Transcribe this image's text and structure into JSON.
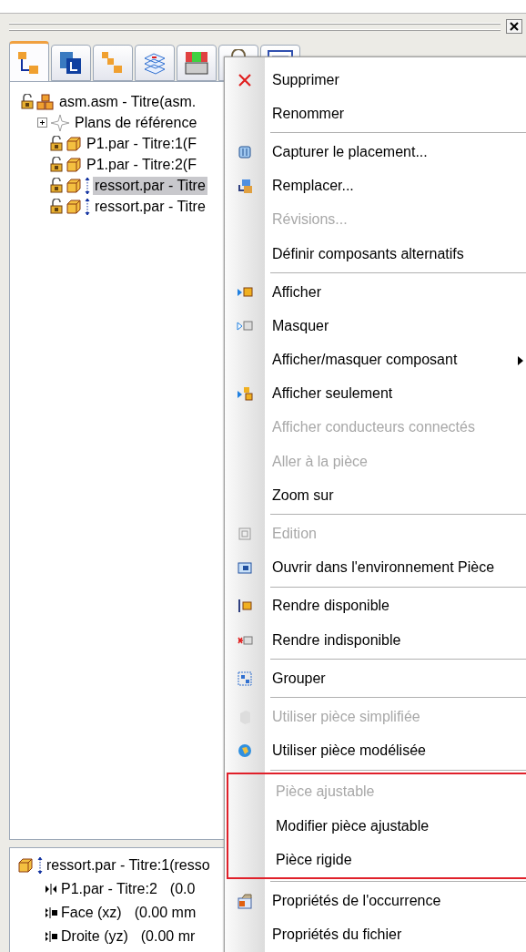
{
  "tabs": [
    {
      "selected": true
    },
    {
      "selected": false
    },
    {
      "selected": false
    },
    {
      "selected": false
    },
    {
      "selected": false
    },
    {
      "selected": false
    },
    {
      "selected": false
    }
  ],
  "tree": {
    "items": [
      {
        "label": "asm.asm - Titre(asm.",
        "selected": false,
        "kind": "assembly",
        "children": [
          {
            "label": "Plans de référence",
            "selected": false,
            "kind": "planes",
            "expanded": false
          },
          {
            "label": "P1.par - Titre:1(F",
            "selected": false,
            "kind": "part"
          },
          {
            "label": "P1.par - Titre:2(F",
            "selected": false,
            "kind": "part"
          },
          {
            "label": "ressort.par - Titre",
            "selected": true,
            "kind": "adjustable"
          },
          {
            "label": "ressort.par - Titre",
            "selected": false,
            "kind": "adjustable"
          }
        ]
      }
    ]
  },
  "details": {
    "header": "ressort.par - Titre:1(resso",
    "rows": [
      {
        "kind": "mate",
        "label": "P1.par - Titre:2",
        "value": "(0.0"
      },
      {
        "kind": "align",
        "label": "Face (xz)",
        "value": "(0.00 mm"
      },
      {
        "kind": "align",
        "label": "Droite (yz)",
        "value": "(0.00 mr"
      }
    ]
  },
  "context_menu": {
    "sections": [
      {
        "highlighted": false,
        "items": [
          {
            "label": "Supprimer",
            "disabled": false,
            "submenu": false
          },
          {
            "label": "Renommer",
            "disabled": false,
            "submenu": false
          }
        ]
      },
      {
        "highlighted": false,
        "items": [
          {
            "label": "Capturer le placement...",
            "disabled": false,
            "submenu": false
          },
          {
            "label": "Remplacer...",
            "disabled": false,
            "submenu": false
          },
          {
            "label": "Révisions...",
            "disabled": true,
            "submenu": false
          },
          {
            "label": "Définir composants alternatifs",
            "disabled": false,
            "submenu": false
          }
        ]
      },
      {
        "highlighted": false,
        "items": [
          {
            "label": "Afficher",
            "disabled": false,
            "submenu": false
          },
          {
            "label": "Masquer",
            "disabled": false,
            "submenu": false
          },
          {
            "label": "Afficher/masquer composant",
            "disabled": false,
            "submenu": true
          },
          {
            "label": "Afficher seulement",
            "disabled": false,
            "submenu": false
          },
          {
            "label": "Afficher conducteurs connectés",
            "disabled": true,
            "submenu": false
          },
          {
            "label": "Aller à la pièce",
            "disabled": true,
            "submenu": false
          },
          {
            "label": "Zoom sur",
            "disabled": false,
            "submenu": false
          }
        ]
      },
      {
        "highlighted": false,
        "items": [
          {
            "label": "Edition",
            "disabled": true,
            "submenu": false
          },
          {
            "label": "Ouvrir dans l'environnement Pièce",
            "disabled": false,
            "submenu": false
          }
        ]
      },
      {
        "highlighted": false,
        "items": [
          {
            "label": "Rendre disponible",
            "disabled": false,
            "submenu": false
          },
          {
            "label": "Rendre indisponible",
            "disabled": false,
            "submenu": false
          }
        ]
      },
      {
        "highlighted": false,
        "items": [
          {
            "label": "Grouper",
            "disabled": false,
            "submenu": false
          }
        ]
      },
      {
        "highlighted": false,
        "items": [
          {
            "label": "Utiliser pièce simplifiée",
            "disabled": true,
            "submenu": false
          },
          {
            "label": "Utiliser pièce modélisée",
            "disabled": false,
            "submenu": false
          }
        ]
      },
      {
        "highlighted": true,
        "items": [
          {
            "label": "Pièce ajustable",
            "disabled": true,
            "submenu": false
          },
          {
            "label": "Modifier pièce ajustable",
            "disabled": false,
            "submenu": false
          },
          {
            "label": "Pièce rigide",
            "disabled": false,
            "submenu": false
          }
        ]
      },
      {
        "highlighted": false,
        "items": [
          {
            "label": "Propriétés de l'occurrence",
            "disabled": false,
            "submenu": false
          },
          {
            "label": "Propriétés du fichier",
            "disabled": false,
            "submenu": false
          }
        ]
      }
    ]
  }
}
